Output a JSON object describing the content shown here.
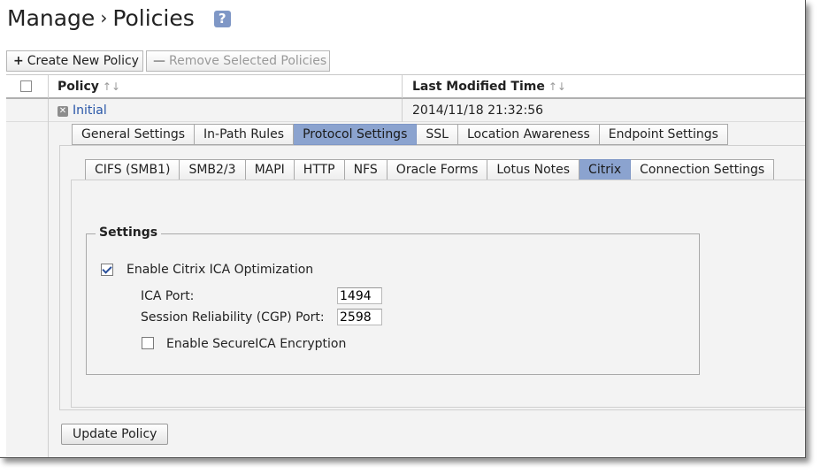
{
  "header": {
    "title_section": "Manage",
    "title_separator": "›",
    "title_page": "Policies",
    "help_label": "?"
  },
  "toolbar": {
    "create_icon": "+",
    "create_label": "Create New Policy",
    "remove_icon": "—",
    "remove_label": "Remove Selected Policies"
  },
  "table": {
    "columns": [
      "Policy",
      "Last Modified Time"
    ],
    "sort_glyph": "↑↓",
    "rows": [
      {
        "name": "Initial",
        "modified": "2014/11/18 21:32:56"
      }
    ]
  },
  "tabs": {
    "main": [
      "General Settings",
      "In-Path Rules",
      "Protocol Settings",
      "SSL",
      "Location Awareness",
      "Endpoint Settings"
    ],
    "main_active": "Protocol Settings",
    "protocol": [
      "CIFS (SMB1)",
      "SMB2/3",
      "MAPI",
      "HTTP",
      "NFS",
      "Oracle Forms",
      "Lotus Notes",
      "Citrix",
      "Connection Settings"
    ],
    "protocol_active": "Citrix"
  },
  "settings": {
    "legend": "Settings",
    "enable_ica_label": "Enable Citrix ICA Optimization",
    "enable_ica_checked": true,
    "ica_port_label": "ICA Port:",
    "ica_port_value": "1494",
    "cgp_port_label": "Session Reliability (CGP) Port:",
    "cgp_port_value": "2598",
    "secure_ica_label": "Enable SecureICA Encryption",
    "secure_ica_checked": false
  },
  "actions": {
    "update_label": "Update Policy"
  },
  "colors": {
    "active_tab": "#8ba3cf",
    "help_badge": "#7f97c6",
    "link": "#2a57a8"
  }
}
